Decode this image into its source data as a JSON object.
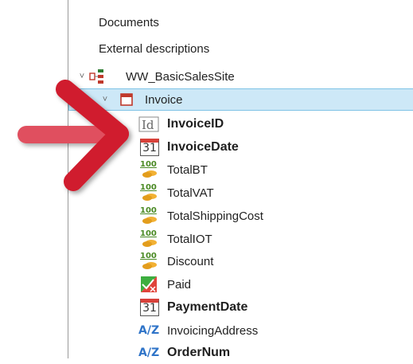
{
  "tree": {
    "documents": {
      "label": "Documents"
    },
    "external_descriptions": {
      "label": "External descriptions"
    },
    "module": {
      "label": "WW_BasicSalesSite",
      "icon": "module-tree-icon"
    },
    "transaction": {
      "label": "Invoice",
      "icon": "transaction-icon",
      "selected": true
    },
    "attributes": [
      {
        "label": "InvoiceID",
        "icon": "id-icon",
        "bold": true
      },
      {
        "label": "InvoiceDate",
        "icon": "calendar-icon",
        "icon_text": "31",
        "bold": true
      },
      {
        "label": "TotalBT",
        "icon": "numeric-icon",
        "icon_text": "100",
        "bold": false
      },
      {
        "label": "TotalVAT",
        "icon": "numeric-icon",
        "icon_text": "100",
        "bold": false
      },
      {
        "label": "TotalShippingCost",
        "icon": "numeric-icon",
        "icon_text": "100",
        "bold": false
      },
      {
        "label": "TotalIOT",
        "icon": "numeric-icon",
        "icon_text": "100",
        "bold": false
      },
      {
        "label": "Discount",
        "icon": "numeric-icon",
        "icon_text": "100",
        "bold": false
      },
      {
        "label": "Paid",
        "icon": "boolean-icon",
        "bold": false
      },
      {
        "label": "PaymentDate",
        "icon": "calendar-icon",
        "icon_text": "31",
        "bold": true
      },
      {
        "label": "InvoicingAddress",
        "icon": "character-icon",
        "icon_text": "A/Z",
        "bold": false
      },
      {
        "label": "OrderNum",
        "icon": "character-icon",
        "icon_text": "A/Z",
        "bold": true
      }
    ]
  },
  "colors": {
    "selection": "#cde8f7",
    "arrow": "#e0505f",
    "annotation_mark": "#d01f2d"
  }
}
